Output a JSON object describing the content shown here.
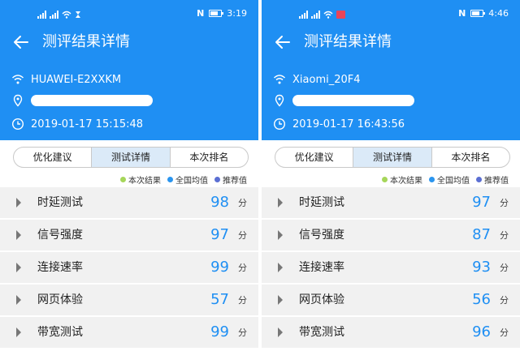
{
  "panels": [
    {
      "status": {
        "time": "3:19"
      },
      "header": {
        "title": "测评结果详情"
      },
      "info": {
        "ssid": "HUAWEI-E2XXKM",
        "datetime": "2019-01-17 15:15:48"
      },
      "tabs": [
        {
          "label": "优化建议",
          "active": false
        },
        {
          "label": "测试详情",
          "active": true
        },
        {
          "label": "本次排名",
          "active": false
        }
      ],
      "legend": [
        {
          "label": "本次结果",
          "color": "#a6d65a"
        },
        {
          "label": "全国均值",
          "color": "#2a95ef"
        },
        {
          "label": "推荐值",
          "color": "#5b6fd3"
        }
      ],
      "items": [
        {
          "label": "时延测试",
          "score": "98",
          "unit": "分"
        },
        {
          "label": "信号强度",
          "score": "97",
          "unit": "分"
        },
        {
          "label": "连接速率",
          "score": "99",
          "unit": "分"
        },
        {
          "label": "网页体验",
          "score": "57",
          "unit": "分"
        },
        {
          "label": "带宽测试",
          "score": "99",
          "unit": "分"
        }
      ]
    },
    {
      "status": {
        "time": "4:46"
      },
      "header": {
        "title": "测评结果详情"
      },
      "info": {
        "ssid": "Xiaomi_20F4",
        "datetime": "2019-01-17 16:43:56"
      },
      "tabs": [
        {
          "label": "优化建议",
          "active": false
        },
        {
          "label": "测试详情",
          "active": true
        },
        {
          "label": "本次排名",
          "active": false
        }
      ],
      "legend": [
        {
          "label": "本次结果",
          "color": "#a6d65a"
        },
        {
          "label": "全国均值",
          "color": "#2a95ef"
        },
        {
          "label": "推荐值",
          "color": "#5b6fd3"
        }
      ],
      "items": [
        {
          "label": "时延测试",
          "score": "97",
          "unit": "分"
        },
        {
          "label": "信号强度",
          "score": "87",
          "unit": "分"
        },
        {
          "label": "连接速率",
          "score": "93",
          "unit": "分"
        },
        {
          "label": "网页体验",
          "score": "56",
          "unit": "分"
        },
        {
          "label": "带宽测试",
          "score": "96",
          "unit": "分"
        }
      ]
    }
  ]
}
